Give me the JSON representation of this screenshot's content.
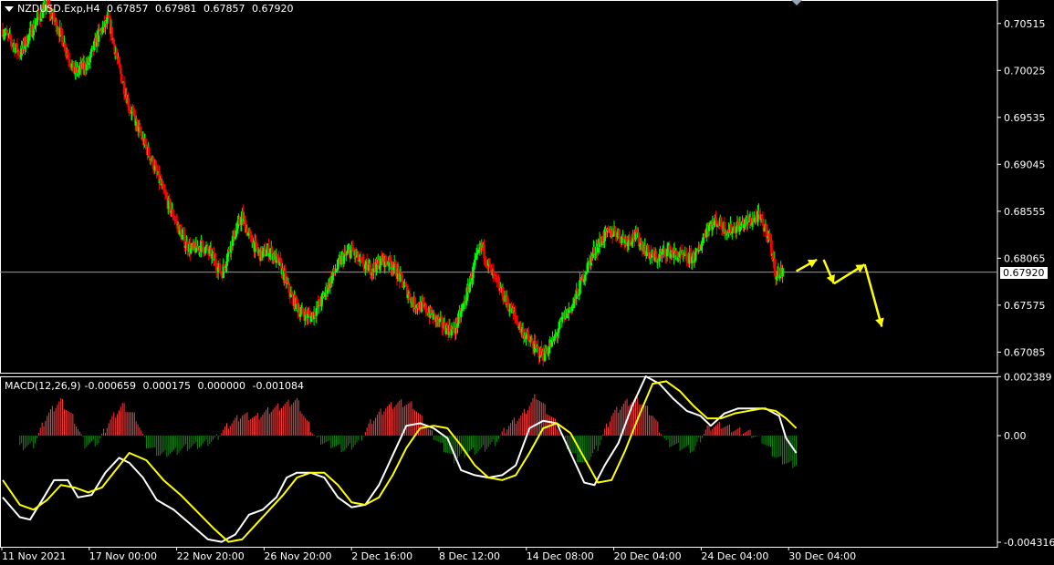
{
  "header": {
    "symbol": "NZDUSD.Exp,H4",
    "open": "0.67857",
    "high": "0.67981",
    "low": "0.67857",
    "close": "0.67920"
  },
  "current_price_label": "0.67920",
  "macd_header": {
    "label": "MACD(12,26,9)",
    "v1": "-0.000659",
    "v2": "0.000175",
    "v3": "0.000000",
    "v4": "-0.001084"
  },
  "colors": {
    "background": "#000000",
    "bull": "#00ff00",
    "bear": "#ff0000",
    "macd_line": "#ffffff",
    "signal_line": "#ffff00",
    "hist_pos": "#ff3b3b",
    "hist_neg": "#0f8a0f",
    "arrow": "#ffff00",
    "grid_border": "#ffffff"
  },
  "chart_data": [
    {
      "type": "candlestick",
      "title": "NZDUSD.Exp,H4",
      "ylim": [
        0.6687,
        0.7076
      ],
      "price_ticks": [
        "0.70515",
        "0.70025",
        "0.69535",
        "0.69045",
        "0.68555",
        "0.68065",
        "0.67575",
        "0.67085"
      ],
      "price_tick_values": [
        0.70515,
        0.70025,
        0.69535,
        0.69045,
        0.68555,
        0.68065,
        0.67575,
        0.67085
      ],
      "current_price": 0.6792,
      "x_ticks": [
        "11 Nov 2021",
        "17 Nov 00:00",
        "22 Nov 20:00",
        "26 Nov 20:00",
        "2 Dec 16:00",
        "8 Dec 12:00",
        "14 Dec 08:00",
        "20 Dec 04:00",
        "24 Dec 04:00",
        "30 Dec 04:00"
      ],
      "close_path": [
        [
          0,
          0.7045
        ],
        [
          5,
          0.702
        ],
        [
          10,
          0.7055
        ],
        [
          13,
          0.707
        ],
        [
          17,
          0.704
        ],
        [
          21,
          0.7
        ],
        [
          25,
          0.701
        ],
        [
          28,
          0.704
        ],
        [
          31,
          0.7055
        ],
        [
          34,
          0.7005
        ],
        [
          37,
          0.6965
        ],
        [
          41,
          0.693
        ],
        [
          44,
          0.6905
        ],
        [
          47,
          0.6875
        ],
        [
          50,
          0.685
        ],
        [
          53,
          0.6825
        ],
        [
          55,
          0.6815
        ],
        [
          58,
          0.682
        ],
        [
          61,
          0.681
        ],
        [
          64,
          0.679
        ],
        [
          67,
          0.6825
        ],
        [
          70,
          0.685
        ],
        [
          72,
          0.683
        ],
        [
          75,
          0.681
        ],
        [
          78,
          0.6815
        ],
        [
          81,
          0.68
        ],
        [
          84,
          0.677
        ],
        [
          87,
          0.675
        ],
        [
          90,
          0.6745
        ],
        [
          93,
          0.676
        ],
        [
          96,
          0.6785
        ],
        [
          99,
          0.6805
        ],
        [
          102,
          0.6815
        ],
        [
          105,
          0.68
        ],
        [
          108,
          0.6795
        ],
        [
          111,
          0.6805
        ],
        [
          114,
          0.68
        ],
        [
          117,
          0.678
        ],
        [
          120,
          0.676
        ],
        [
          123,
          0.6755
        ],
        [
          126,
          0.6745
        ],
        [
          129,
          0.6735
        ],
        [
          132,
          0.673
        ],
        [
          135,
          0.676
        ],
        [
          138,
          0.68
        ],
        [
          140,
          0.682
        ],
        [
          143,
          0.679
        ],
        [
          146,
          0.677
        ],
        [
          149,
          0.675
        ],
        [
          152,
          0.673
        ],
        [
          155,
          0.6715
        ],
        [
          158,
          0.6705
        ],
        [
          161,
          0.672
        ],
        [
          164,
          0.6745
        ],
        [
          167,
          0.676
        ],
        [
          170,
          0.679
        ],
        [
          173,
          0.6815
        ],
        [
          176,
          0.683
        ],
        [
          179,
          0.6835
        ],
        [
          182,
          0.6825
        ],
        [
          185,
          0.683
        ],
        [
          188,
          0.6815
        ],
        [
          191,
          0.6805
        ],
        [
          194,
          0.6815
        ],
        [
          197,
          0.681
        ],
        [
          200,
          0.6805
        ],
        [
          203,
          0.681
        ],
        [
          206,
          0.684
        ],
        [
          209,
          0.6845
        ],
        [
          212,
          0.6835
        ],
        [
          215,
          0.684
        ],
        [
          218,
          0.6845
        ],
        [
          221,
          0.685
        ],
        [
          224,
          0.683
        ],
        [
          226,
          0.679
        ],
        [
          228,
          0.6792
        ]
      ],
      "arrows": [
        [
          [
            232,
            0.6793
          ],
          [
            238,
            0.6805
          ]
        ],
        [
          [
            240,
            0.6805
          ],
          [
            243,
            0.678
          ]
        ],
        [
          [
            243,
            0.678
          ],
          [
            252,
            0.68
          ]
        ],
        [
          [
            252,
            0.68
          ],
          [
            257,
            0.6735
          ]
        ]
      ],
      "total_bars": 290
    },
    {
      "type": "line",
      "title": "MACD(12,26,9)",
      "ylim": [
        -0.0045,
        0.0024
      ],
      "y_ticks": [
        "0.002389",
        "0.00",
        "-0.004316"
      ],
      "y_tick_values": [
        0.002389,
        0.0,
        -0.004316
      ],
      "series": [
        {
          "name": "MACD",
          "points": [
            [
              0,
              -0.0025
            ],
            [
              5,
              -0.0033
            ],
            [
              8,
              -0.0034
            ],
            [
              12,
              -0.0025
            ],
            [
              15,
              -0.0018
            ],
            [
              19,
              -0.0018
            ],
            [
              22,
              -0.0025
            ],
            [
              26,
              -0.0024
            ],
            [
              30,
              -0.0015
            ],
            [
              34,
              -0.0009
            ],
            [
              37,
              -0.0011
            ],
            [
              41,
              -0.0017
            ],
            [
              45,
              -0.0026
            ],
            [
              50,
              -0.003
            ],
            [
              55,
              -0.0036
            ],
            [
              60,
              -0.0042
            ],
            [
              64,
              -0.0043
            ],
            [
              68,
              -0.004
            ],
            [
              72,
              -0.0032
            ],
            [
              76,
              -0.003
            ],
            [
              80,
              -0.0025
            ],
            [
              83,
              -0.0017
            ],
            [
              86,
              -0.0015
            ],
            [
              90,
              -0.0015
            ],
            [
              94,
              -0.0017
            ],
            [
              98,
              -0.0025
            ],
            [
              102,
              -0.0029
            ],
            [
              106,
              -0.0028
            ],
            [
              110,
              -0.002
            ],
            [
              114,
              -0.0008
            ],
            [
              118,
              0.0004
            ],
            [
              122,
              0.0005
            ],
            [
              126,
              0.0003
            ],
            [
              130,
              -0.0001
            ],
            [
              134,
              -0.0014
            ],
            [
              138,
              -0.0016
            ],
            [
              142,
              -0.0017
            ],
            [
              146,
              -0.0016
            ],
            [
              150,
              -0.0012
            ],
            [
              154,
              0.0003
            ],
            [
              158,
              0.0006
            ],
            [
              162,
              0.0005
            ],
            [
              166,
              -0.0007
            ],
            [
              170,
              -0.0019
            ],
            [
              173,
              -0.002
            ],
            [
              176,
              -0.0012
            ],
            [
              180,
              -0.0003
            ],
            [
              184,
              0.0012
            ],
            [
              188,
              0.0024
            ],
            [
              192,
              0.0021
            ],
            [
              196,
              0.0015
            ],
            [
              200,
              0.001
            ],
            [
              204,
              0.0008
            ],
            [
              207,
              0.0004
            ],
            [
              211,
              0.0009
            ],
            [
              215,
              0.0011
            ],
            [
              219,
              0.0011
            ],
            [
              223,
              0.0011
            ],
            [
              227,
              0.0008
            ],
            [
              229,
              -0.0001
            ],
            [
              232,
              -0.0007
            ]
          ]
        },
        {
          "name": "Signal",
          "points": [
            [
              0,
              -0.0018
            ],
            [
              5,
              -0.0028
            ],
            [
              9,
              -0.003
            ],
            [
              13,
              -0.0026
            ],
            [
              17,
              -0.002
            ],
            [
              21,
              -0.0021
            ],
            [
              25,
              -0.0023
            ],
            [
              29,
              -0.0021
            ],
            [
              33,
              -0.0014
            ],
            [
              37,
              -0.0007
            ],
            [
              42,
              -0.001
            ],
            [
              47,
              -0.0018
            ],
            [
              52,
              -0.0024
            ],
            [
              57,
              -0.0031
            ],
            [
              62,
              -0.0038
            ],
            [
              66,
              -0.0043
            ],
            [
              70,
              -0.0042
            ],
            [
              74,
              -0.0036
            ],
            [
              78,
              -0.003
            ],
            [
              82,
              -0.0024
            ],
            [
              86,
              -0.0017
            ],
            [
              90,
              -0.0015
            ],
            [
              94,
              -0.0015
            ],
            [
              98,
              -0.002
            ],
            [
              102,
              -0.0027
            ],
            [
              106,
              -0.0028
            ],
            [
              110,
              -0.0025
            ],
            [
              114,
              -0.0016
            ],
            [
              118,
              -0.0005
            ],
            [
              122,
              0.0003
            ],
            [
              126,
              0.0004
            ],
            [
              130,
              0.0003
            ],
            [
              134,
              -0.0004
            ],
            [
              138,
              -0.0012
            ],
            [
              142,
              -0.0017
            ],
            [
              146,
              -0.0018
            ],
            [
              150,
              -0.0016
            ],
            [
              154,
              -0.0007
            ],
            [
              158,
              0.0003
            ],
            [
              162,
              0.0005
            ],
            [
              166,
              0.0001
            ],
            [
              170,
              -0.0009
            ],
            [
              174,
              -0.0019
            ],
            [
              178,
              -0.0018
            ],
            [
              182,
              -0.0006
            ],
            [
              186,
              0.0008
            ],
            [
              190,
              0.0021
            ],
            [
              194,
              0.0022
            ],
            [
              198,
              0.0018
            ],
            [
              202,
              0.0012
            ],
            [
              206,
              0.0007
            ],
            [
              210,
              0.0007
            ],
            [
              214,
              0.0009
            ],
            [
              218,
              0.001
            ],
            [
              222,
              0.0011
            ],
            [
              226,
              0.001
            ],
            [
              229,
              0.0007
            ],
            [
              232,
              0.0003
            ]
          ]
        }
      ],
      "histogram": [
        [
          5,
          -0.0005
        ],
        [
          9,
          -0.0004
        ],
        [
          13,
          0.0008
        ],
        [
          17,
          0.0014
        ],
        [
          21,
          0.0006
        ],
        [
          24,
          -0.0004
        ],
        [
          28,
          -0.0003
        ],
        [
          31,
          0.0005
        ],
        [
          35,
          0.0012
        ],
        [
          39,
          0.0007
        ],
        [
          42,
          -0.0004
        ],
        [
          46,
          -0.0008
        ],
        [
          50,
          -0.0007
        ],
        [
          54,
          -0.0005
        ],
        [
          58,
          -0.0004
        ],
        [
          62,
          -0.0002
        ],
        [
          66,
          0.0004
        ],
        [
          70,
          0.0008
        ],
        [
          74,
          0.0007
        ],
        [
          78,
          0.001
        ],
        [
          82,
          0.0012
        ],
        [
          86,
          0.0014
        ],
        [
          89,
          0.0005
        ],
        [
          92,
          -0.0002
        ],
        [
          96,
          -0.0004
        ],
        [
          100,
          -0.0006
        ],
        [
          104,
          -0.0003
        ],
        [
          108,
          0.0006
        ],
        [
          112,
          0.0011
        ],
        [
          116,
          0.0013
        ],
        [
          120,
          0.0012
        ],
        [
          124,
          0.0003
        ],
        [
          128,
          -0.0004
        ],
        [
          132,
          -0.001
        ],
        [
          136,
          -0.0007
        ],
        [
          140,
          -0.0006
        ],
        [
          144,
          -0.0003
        ],
        [
          148,
          0.0004
        ],
        [
          152,
          0.0008
        ],
        [
          156,
          0.0016
        ],
        [
          158,
          0.0012
        ],
        [
          162,
          0.0004
        ],
        [
          166,
          -0.0007
        ],
        [
          170,
          -0.0012
        ],
        [
          174,
          -0.0005
        ],
        [
          178,
          0.0008
        ],
        [
          182,
          0.0013
        ],
        [
          186,
          0.0014
        ],
        [
          190,
          0.0008
        ],
        [
          194,
          -0.0003
        ],
        [
          198,
          -0.0005
        ],
        [
          202,
          -0.0006
        ],
        [
          206,
          0.0003
        ],
        [
          210,
          0.0004
        ],
        [
          214,
          0.0002
        ],
        [
          218,
          0.0001
        ],
        [
          222,
          -0.0002
        ],
        [
          226,
          -0.0009
        ],
        [
          230,
          -0.0012
        ],
        [
          232,
          -0.0012
        ]
      ],
      "total_bars": 290
    }
  ]
}
